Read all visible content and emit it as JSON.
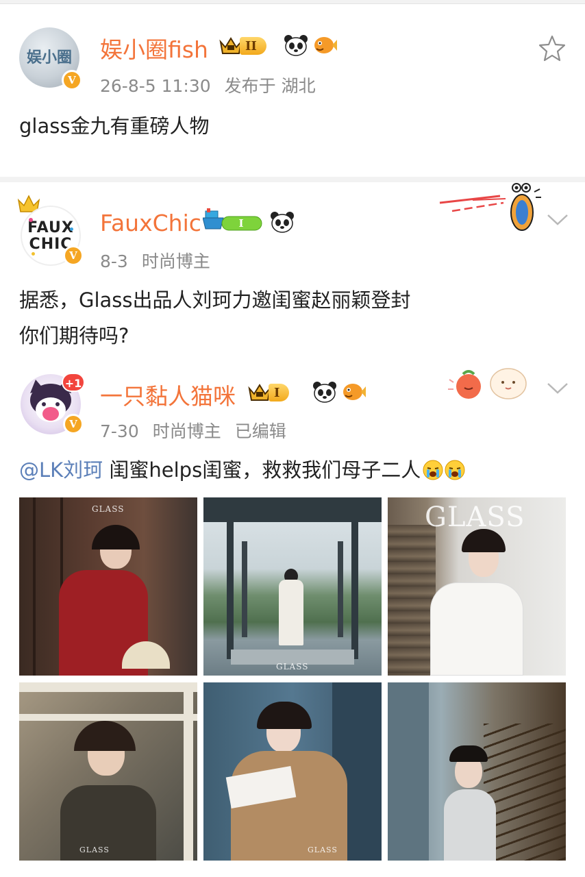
{
  "post1": {
    "avatar_text": "娱小圈",
    "username": "娱小圈fish",
    "level": "II",
    "timestamp": "26-8-5 11:30",
    "location_prefix": "发布于",
    "location": "湖北",
    "text": "glass金九有重磅人物",
    "icons": [
      "star-icon",
      "crown-icon",
      "panda-icon",
      "fish-icon"
    ]
  },
  "comment1": {
    "avatar_text_line1": "FAUX",
    "avatar_text_line2": "CHIC",
    "username": "FauxChic",
    "level": "I",
    "date": "8-3",
    "role": "时尚博主",
    "text_line1": "据悉，Glass出品人刘珂力邀闺蜜赵丽颖登封",
    "text_line2": "你们期待吗?",
    "icons": [
      "boat-badge-icon",
      "panda-icon",
      "chevron-down-icon"
    ]
  },
  "comment2": {
    "avatar_badge": "+1",
    "username": "一只黏人猫咪",
    "level": "I",
    "date": "7-30",
    "role": "时尚博主",
    "edited": "已编辑",
    "mention": "@LK刘珂",
    "text": "闺蜜helps闺蜜，救救我们母子二人",
    "icons": [
      "crying-emoji-icon",
      "crown-icon",
      "panda-icon",
      "fish-icon",
      "chevron-down-icon"
    ]
  },
  "photos": {
    "wm1": "GLASS",
    "wm2": "GLASS",
    "wm3": "GLASS",
    "wm4": "GLASS",
    "wm5": "GLASS",
    "colors": [
      "#5a2420",
      "#7f9a8c",
      "#d9d5cf",
      "#6e6a60",
      "#4f6d82",
      "#57636b"
    ]
  },
  "colors": {
    "name": "#f3743a",
    "meta": "#8a8a8a",
    "mention": "#5b7fb8",
    "badge": "#f5a623"
  }
}
